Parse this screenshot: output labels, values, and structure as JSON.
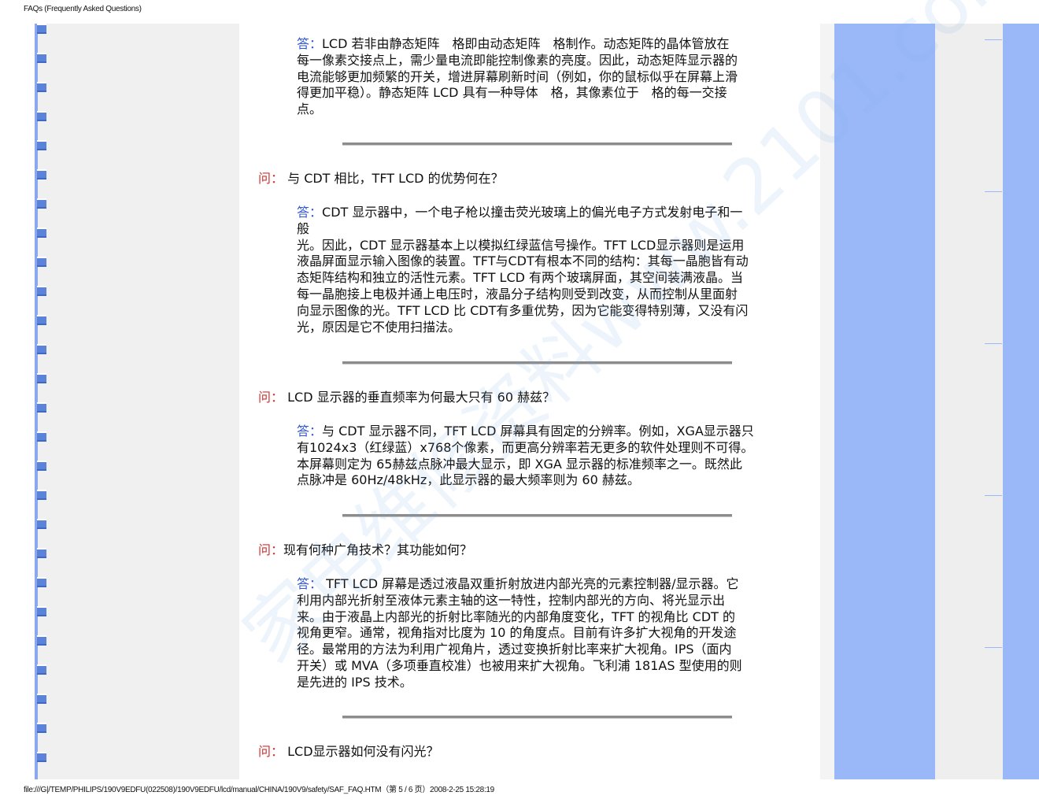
{
  "page": {
    "header": "FAQs (Frequently Asked Questions)",
    "footer": "file:///G|/TEMP/PHILIPS/190V9EDFU(022508)/190V9EDFU/lcd/manual/CHINA/190V9/safety/SAF_FAQ.HTM（第 5 / 6 页）2008-2-25 15:28:19",
    "watermark": "家电维修资料www.2101.com"
  },
  "faq": {
    "q_label": "问：",
    "a_label": "答：",
    "answer0": {
      "lines": [
        "LCD 若非由静态矩阵　格即由动态矩阵　格制作。动态矩阵的晶体管放在",
        "每一像素交接点上，需少量电流即能控制像素的亮度。因此，动态矩阵显示器的",
        "电流能够更加频繁的开关，增进屏幕刷新时间（例如，你的鼠标似乎在屏幕上滑",
        "得更加平稳）。静态矩阵 LCD 具有一种导体　格，其像素位于　格的每一交接",
        "点。"
      ]
    },
    "q1": {
      "text": " 与 CDT 相比，TFT LCD 的优势何在？"
    },
    "answer1": {
      "lines": [
        "CDT 显示器中，一个电子枪以撞击荧光玻璃上的偏光电子方式发射电子和一",
        "般",
        "光。因此，CDT 显示器基本上以模拟红绿蓝信号操作。TFT LCD显示器则是运用",
        "液晶屏面显示输入图像的装置。TFT与CDT有根本不同的结构：其每一晶胞皆有动",
        "态矩阵结构和独立的活性元素。TFT LCD 有两个玻璃屏面，其空间装满液晶。当",
        "每一晶胞接上电极并通上电压时，液晶分子结构则受到改变，从而控制从里面射",
        "向显示图像的光。TFT LCD 比 CDT有多重优势，因为它能变得特别薄，又没有闪",
        "光，原因是它不使用扫描法。"
      ]
    },
    "q2": {
      "text": " LCD 显示器的垂直频率为何最大只有 60 赫兹？"
    },
    "answer2": {
      "lines": [
        "与 CDT 显示器不同，TFT LCD 屏幕具有固定的分辨率。例如，XGA显示器只",
        "有1024x3（红绿蓝）x768个像素，而更高分辨率若无更多的软件处理则不可得。",
        "本屏幕则定为 65赫兹点脉冲最大显示，即 XGA 显示器的标准频率之一。既然此",
        "点脉冲是 60Hz/48kHz，此显示器的最大频率则为 60 赫兹。"
      ]
    },
    "q3": {
      "text": "现有何种广角技术？其功能如何？"
    },
    "answer3": {
      "lines": [
        " TFT LCD 屏幕是透过液晶双重折射放进内部光亮的元素控制器/显示器。它",
        "利用内部光折射至液体元素主轴的这一特性，控制内部光的方向、将光显示出",
        "来。由于液晶上内部光的折射比率随光的内部角度变化，TFT 的视角比 CDT 的",
        "视角更窄。通常，视角指对比度为 10 的角度点。目前有许多扩大视角的开发途",
        "径。最常用的方法为利用广视角片，透过变换折射比率来扩大视角。IPS（面内",
        "开关）或 MVA（多项垂直校准）也被用来扩大视角。飞利浦 181AS 型使用的则",
        "是先进的 IPS 技术。"
      ]
    },
    "q4": {
      "text": " LCD显示器如何没有闪光？"
    }
  },
  "colors": {
    "question_label": "#d03030",
    "answer_label": "#2f55d4",
    "sidebar_blue": "#9ab8f8",
    "bullet_blue": "#5b83da"
  },
  "icons": {
    "sidebar_bullet": "blue-square-bullet-icon"
  }
}
